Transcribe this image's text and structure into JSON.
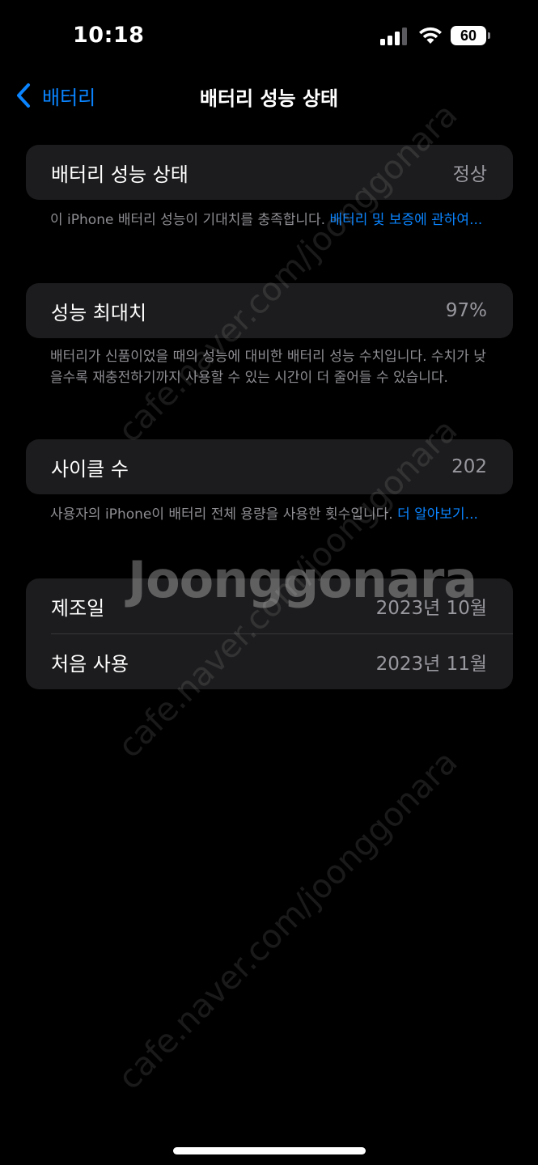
{
  "status_bar": {
    "time": "10:18",
    "battery_level": "60",
    "icons": [
      "cellular-signal-icon",
      "wifi-icon",
      "battery-icon"
    ]
  },
  "nav": {
    "back_label": "배터리",
    "title": "배터리 성능 상태"
  },
  "health_section": {
    "label": "배터리 성능 상태",
    "value": "정상",
    "footnote_text": "이 iPhone 배터리 성능이 기대치를 충족합니다. ",
    "footnote_link": "배터리 및 보증에 관하여..."
  },
  "capacity_section": {
    "label": "성능 최대치",
    "value": "97%",
    "footnote_text": "배터리가 신품이었을 때의 성능에 대비한 배터리 성능 수치입니다. 수치가 낮을수록 재충전하기까지 사용할 수 있는 시간이 더 줄어들 수 있습니다."
  },
  "cycle_section": {
    "label": "사이클 수",
    "value": "202",
    "footnote_text": "사용자의 iPhone이 배터리 전체 용량을 사용한 횟수입니다. ",
    "footnote_link": "더 알아보기..."
  },
  "dates_section": {
    "manufacture_label": "제조일",
    "manufacture_value": "2023년 10월",
    "first_use_label": "처음 사용",
    "first_use_value": "2023년 11월"
  },
  "watermark": {
    "text": "cafe.naver.com/joonggonara",
    "logo": "Joonggonara"
  },
  "colors": {
    "background": "#000000",
    "card": "#1c1c1e",
    "accent": "#0a84ff",
    "secondary_text": "#8e8e93",
    "divider": "#38383a"
  }
}
